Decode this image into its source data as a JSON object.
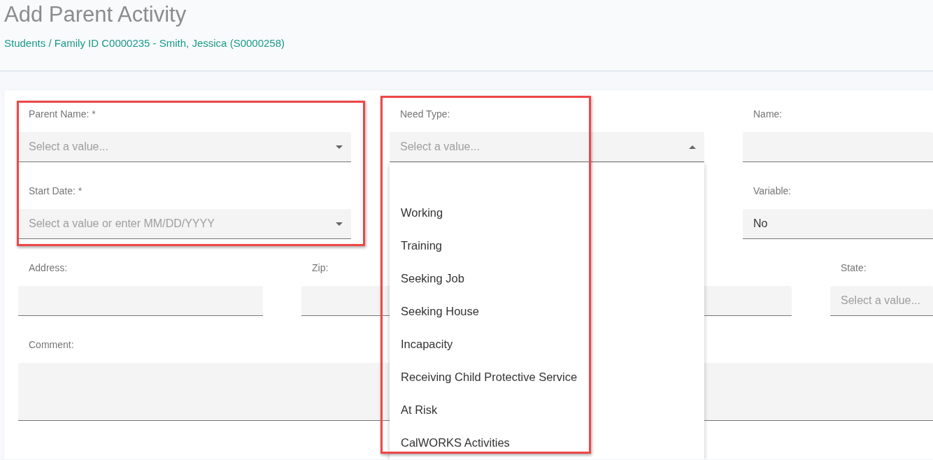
{
  "header": {
    "title": "Add Parent Activity",
    "breadcrumb": "Students / Family ID C0000235 - Smith, Jessica (S0000258)"
  },
  "form": {
    "rows": [
      {
        "fields": [
          {
            "label": "Parent Name: *",
            "kind": "select",
            "placeholder": "Select a value...",
            "expanded": false
          },
          {
            "label": "Need Type:",
            "kind": "select",
            "placeholder": "Select a value...",
            "expanded": true
          },
          {
            "label": "Name:",
            "kind": "text"
          }
        ]
      },
      {
        "fields": [
          {
            "label": "Start Date: *",
            "kind": "select",
            "placeholder": "Select a value or enter MM/DD/YYYY",
            "expanded": false
          },
          {
            "label": "Variable:",
            "kind": "text",
            "value": "No"
          }
        ]
      },
      {
        "fields": [
          {
            "label": "Address:",
            "kind": "text"
          },
          {
            "label": "Zip:",
            "kind": "text"
          },
          {
            "kind": "text"
          },
          {
            "label": "State:",
            "kind": "select",
            "placeholder": "Select a value..."
          }
        ]
      },
      {
        "fields": [
          {
            "label": "Comment:",
            "kind": "textarea"
          }
        ]
      }
    ]
  },
  "dropdown": {
    "items": [
      {
        "label": "Working"
      },
      {
        "label": "Training"
      },
      {
        "label": "Seeking Job"
      },
      {
        "label": "Seeking House"
      },
      {
        "label": "Incapacity"
      },
      {
        "label": "Receiving Child Protective Service"
      },
      {
        "label": "At Risk"
      },
      {
        "label": "CalWORKS Activities"
      }
    ]
  }
}
